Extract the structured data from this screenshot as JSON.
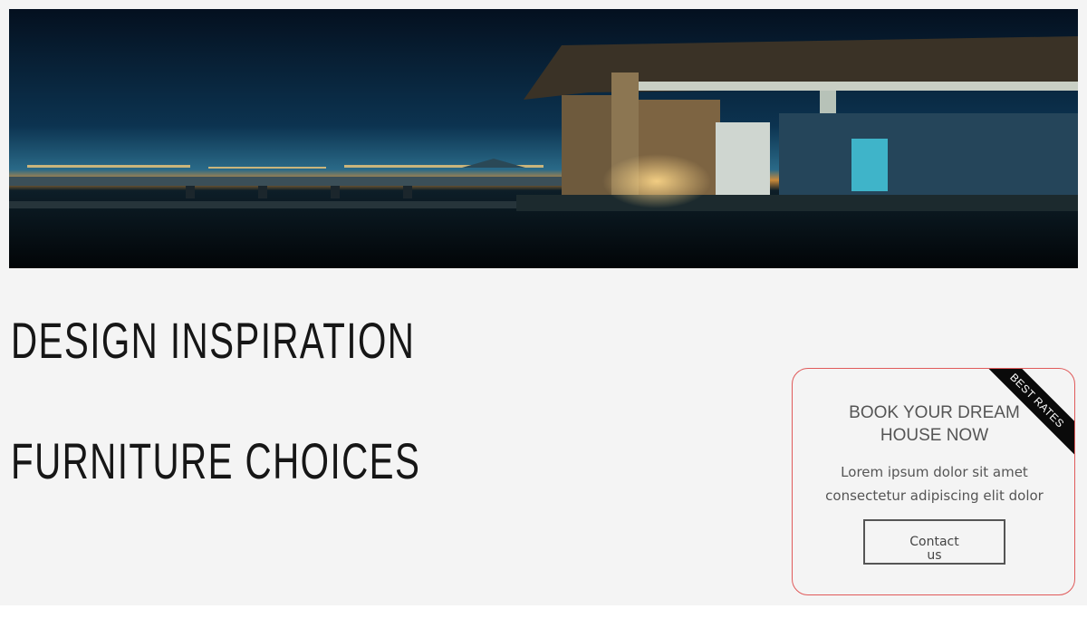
{
  "hero": {
    "image": "night-villa-pier-photo"
  },
  "headings": {
    "line1": "DESIGN INSPIRATION",
    "line2": "FURNITURE CHOICES"
  },
  "card": {
    "ribbon": "BEST RATES",
    "title": "BOOK YOUR DREAM HOUSE NOW",
    "text": "Lorem ipsum dolor sit amet consectetur adipiscing elit dolor",
    "button_label": "Contact us",
    "border_color": "#e05a5a"
  },
  "colors": {
    "background": "#f4f4f4",
    "heading": "#161616",
    "card_text": "#555555"
  }
}
